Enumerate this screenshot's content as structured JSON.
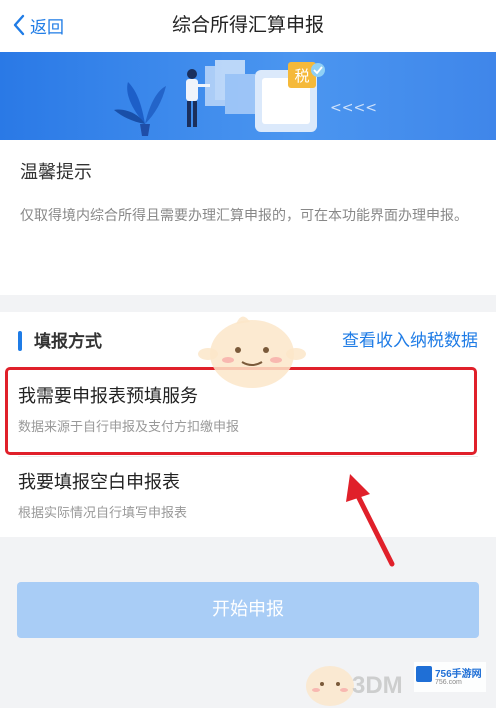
{
  "nav": {
    "back_label": "返回",
    "title": "综合所得汇算申报"
  },
  "banner": {
    "badge_char": "税",
    "arrows": "<<<<"
  },
  "tips": {
    "title": "温馨提示",
    "text": "仅取得境内综合所得且需要办理汇算申报的，可在本功能界面办理申报。"
  },
  "section": {
    "title": "填报方式",
    "link": "查看收入纳税数据"
  },
  "options": [
    {
      "title": "我需要申报表预填服务",
      "subtitle": "数据来源于自行申报及支付方扣缴申报"
    },
    {
      "title": "我要填报空白申报表",
      "subtitle": "根据实际情况自行填写申报表"
    }
  ],
  "submit_label": "开始申报",
  "watermark": {
    "text": "3DM",
    "logo_text": "756手游网",
    "logo_sub": "756.com"
  },
  "colors": {
    "accent": "#1f7ce6",
    "annotation_red": "#e0202a",
    "button_disabled": "#a9cdf6"
  }
}
